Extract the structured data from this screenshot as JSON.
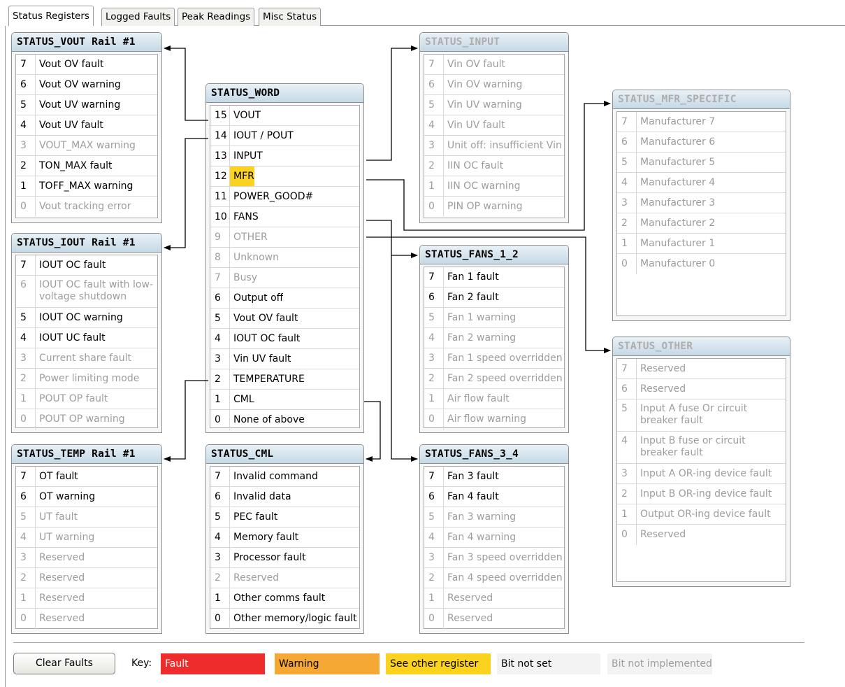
{
  "tabs": [
    "Status Registers",
    "Logged Faults",
    "Peak Readings",
    "Misc Status"
  ],
  "colors": {
    "fault": "#ee2c2c",
    "warning": "#f5a833",
    "see_other": "#fbd21d",
    "bit_not_set": "#f3f3f3",
    "bit_not_implemented": "#f3f3f3"
  },
  "registers": {
    "vout": {
      "title": "STATUS_VOUT Rail #1",
      "rows": [
        {
          "bit": "7",
          "label": "Vout OV fault",
          "state": "set"
        },
        {
          "bit": "6",
          "label": "Vout OV warning",
          "state": "set"
        },
        {
          "bit": "5",
          "label": "Vout UV warning",
          "state": "set"
        },
        {
          "bit": "4",
          "label": "Vout UV fault",
          "state": "set"
        },
        {
          "bit": "3",
          "label": "VOUT_MAX warning",
          "state": "off"
        },
        {
          "bit": "2",
          "label": "TON_MAX fault",
          "state": "set"
        },
        {
          "bit": "1",
          "label": "TOFF_MAX warning",
          "state": "set"
        },
        {
          "bit": "0",
          "label": "Vout tracking error",
          "state": "off"
        }
      ]
    },
    "iout": {
      "title": "STATUS_IOUT Rail #1",
      "rows": [
        {
          "bit": "7",
          "label": "IOUT OC fault",
          "state": "set"
        },
        {
          "bit": "6",
          "label": "IOUT OC fault with low-voltage shutdown",
          "state": "off",
          "tall": true
        },
        {
          "bit": "5",
          "label": "IOUT OC warning",
          "state": "set"
        },
        {
          "bit": "4",
          "label": "IOUT UC fault",
          "state": "set"
        },
        {
          "bit": "3",
          "label": "Current share fault",
          "state": "off"
        },
        {
          "bit": "2",
          "label": "Power limiting mode",
          "state": "off"
        },
        {
          "bit": "1",
          "label": "POUT OP fault",
          "state": "off"
        },
        {
          "bit": "0",
          "label": "POUT OP warning",
          "state": "off"
        }
      ]
    },
    "temp": {
      "title": "STATUS_TEMP Rail #1",
      "rows": [
        {
          "bit": "7",
          "label": "OT fault",
          "state": "set"
        },
        {
          "bit": "6",
          "label": "OT warning",
          "state": "set"
        },
        {
          "bit": "5",
          "label": "UT fault",
          "state": "off"
        },
        {
          "bit": "4",
          "label": "UT warning",
          "state": "off"
        },
        {
          "bit": "3",
          "label": "Reserved",
          "state": "off"
        },
        {
          "bit": "2",
          "label": "Reserved",
          "state": "off"
        },
        {
          "bit": "1",
          "label": "Reserved",
          "state": "off"
        },
        {
          "bit": "0",
          "label": "Reserved",
          "state": "off"
        }
      ]
    },
    "word": {
      "title": "STATUS_WORD",
      "rows": [
        {
          "bit": "15",
          "label": "VOUT",
          "state": "set"
        },
        {
          "bit": "14",
          "label": "IOUT / POUT",
          "state": "set"
        },
        {
          "bit": "13",
          "label": "INPUT",
          "state": "set"
        },
        {
          "bit": "12",
          "label": "MFR",
          "state": "see"
        },
        {
          "bit": "11",
          "label": "POWER_GOOD#",
          "state": "set"
        },
        {
          "bit": "10",
          "label": "FANS",
          "state": "set"
        },
        {
          "bit": "9",
          "label": "OTHER",
          "state": "off"
        },
        {
          "bit": "8",
          "label": "Unknown",
          "state": "off"
        },
        {
          "bit": "7",
          "label": "Busy",
          "state": "off"
        },
        {
          "bit": "6",
          "label": "Output off",
          "state": "set"
        },
        {
          "bit": "5",
          "label": "Vout OV fault",
          "state": "set"
        },
        {
          "bit": "4",
          "label": "IOUT OC fault",
          "state": "set"
        },
        {
          "bit": "3",
          "label": "Vin UV fault",
          "state": "set"
        },
        {
          "bit": "2",
          "label": "TEMPERATURE",
          "state": "set"
        },
        {
          "bit": "1",
          "label": "CML",
          "state": "set"
        },
        {
          "bit": "0",
          "label": "None of above",
          "state": "set"
        }
      ]
    },
    "cml": {
      "title": "STATUS_CML",
      "rows": [
        {
          "bit": "7",
          "label": "Invalid command",
          "state": "set"
        },
        {
          "bit": "6",
          "label": "Invalid data",
          "state": "set"
        },
        {
          "bit": "5",
          "label": "PEC fault",
          "state": "set"
        },
        {
          "bit": "4",
          "label": "Memory fault",
          "state": "set"
        },
        {
          "bit": "3",
          "label": "Processor fault",
          "state": "set"
        },
        {
          "bit": "2",
          "label": "Reserved",
          "state": "off"
        },
        {
          "bit": "1",
          "label": "Other comms fault",
          "state": "set"
        },
        {
          "bit": "0",
          "label": "Other memory/logic fault",
          "state": "set"
        }
      ]
    },
    "input": {
      "title": "STATUS_INPUT",
      "dim": true,
      "rows": [
        {
          "bit": "7",
          "label": "Vin OV fault",
          "state": "off"
        },
        {
          "bit": "6",
          "label": "Vin OV warning",
          "state": "off"
        },
        {
          "bit": "5",
          "label": "Vin UV warning",
          "state": "off"
        },
        {
          "bit": "4",
          "label": "Vin UV fault",
          "state": "off"
        },
        {
          "bit": "3",
          "label": "Unit off: insufficient Vin",
          "state": "off"
        },
        {
          "bit": "2",
          "label": "IIN OC fault",
          "state": "off"
        },
        {
          "bit": "1",
          "label": "IIN OC warning",
          "state": "off"
        },
        {
          "bit": "0",
          "label": "PIN OP warning",
          "state": "off"
        }
      ]
    },
    "fans12": {
      "title": "STATUS_FANS_1_2",
      "rows": [
        {
          "bit": "7",
          "label": "Fan 1 fault",
          "state": "set"
        },
        {
          "bit": "6",
          "label": "Fan 2 fault",
          "state": "set"
        },
        {
          "bit": "5",
          "label": "Fan 1 warning",
          "state": "off"
        },
        {
          "bit": "4",
          "label": "Fan 2 warning",
          "state": "off"
        },
        {
          "bit": "3",
          "label": "Fan 1 speed overridden",
          "state": "off"
        },
        {
          "bit": "2",
          "label": "Fan 2 speed overridden",
          "state": "off"
        },
        {
          "bit": "1",
          "label": "Air flow fault",
          "state": "off"
        },
        {
          "bit": "0",
          "label": "Air flow warning",
          "state": "off"
        }
      ]
    },
    "fans34": {
      "title": "STATUS_FANS_3_4",
      "rows": [
        {
          "bit": "7",
          "label": "Fan 3 fault",
          "state": "set"
        },
        {
          "bit": "6",
          "label": "Fan 4 fault",
          "state": "set"
        },
        {
          "bit": "5",
          "label": "Fan 3 warning",
          "state": "off"
        },
        {
          "bit": "4",
          "label": "Fan 4 warning",
          "state": "off"
        },
        {
          "bit": "3",
          "label": "Fan 3 speed overridden",
          "state": "off"
        },
        {
          "bit": "2",
          "label": "Fan 4 speed overridden",
          "state": "off"
        },
        {
          "bit": "1",
          "label": "Reserved",
          "state": "off"
        },
        {
          "bit": "0",
          "label": "Reserved",
          "state": "off"
        }
      ]
    },
    "mfr": {
      "title": "STATUS_MFR_SPECIFIC",
      "dim": true,
      "rows": [
        {
          "bit": "7",
          "label": "Manufacturer 7",
          "state": "off"
        },
        {
          "bit": "6",
          "label": "Manufacturer 6",
          "state": "off"
        },
        {
          "bit": "5",
          "label": "Manufacturer 5",
          "state": "off"
        },
        {
          "bit": "4",
          "label": "Manufacturer 4",
          "state": "off"
        },
        {
          "bit": "3",
          "label": "Manufacturer 3",
          "state": "off"
        },
        {
          "bit": "2",
          "label": "Manufacturer 2",
          "state": "off"
        },
        {
          "bit": "1",
          "label": "Manufacturer 1",
          "state": "off"
        },
        {
          "bit": "0",
          "label": "Manufacturer 0",
          "state": "off"
        }
      ]
    },
    "other": {
      "title": "STATUS_OTHER",
      "dim": true,
      "rows": [
        {
          "bit": "7",
          "label": "Reserved",
          "state": "off"
        },
        {
          "bit": "6",
          "label": "Reserved",
          "state": "off"
        },
        {
          "bit": "5",
          "label": "Input A fuse Or circuit breaker fault",
          "state": "off",
          "tall": true
        },
        {
          "bit": "4",
          "label": "Input B fuse or circuit breaker fault",
          "state": "off",
          "tall": true
        },
        {
          "bit": "3",
          "label": "Input A OR-ing device fault",
          "state": "off"
        },
        {
          "bit": "2",
          "label": "Input B OR-ing device fault",
          "state": "off"
        },
        {
          "bit": "1",
          "label": "Output OR-ing device fault",
          "state": "off"
        },
        {
          "bit": "0",
          "label": "Reserved",
          "state": "off"
        }
      ]
    }
  },
  "footer": {
    "clear_faults": "Clear Faults",
    "key_label": "Key:",
    "keys": {
      "fault": "Fault",
      "warning": "Warning",
      "see_other": "See other register",
      "bit_not_set": "Bit not set",
      "bit_not_implemented": "Bit not implemented"
    }
  }
}
